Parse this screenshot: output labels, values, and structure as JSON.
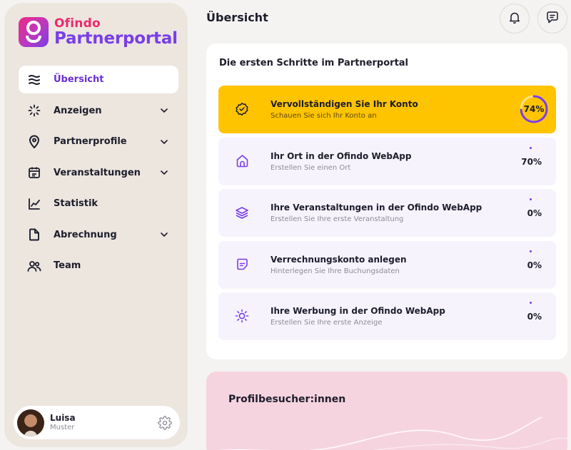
{
  "brand": {
    "line1": "Ofindo",
    "line2": "Partnerportal",
    "accent": "#7a3ee8",
    "pink": "#ec2a6e"
  },
  "sidebar": {
    "items": [
      {
        "label": "Übersicht",
        "icon": "waves-icon",
        "active": true,
        "expandable": false
      },
      {
        "label": "Anzeigen",
        "icon": "sparkle-icon",
        "active": false,
        "expandable": true
      },
      {
        "label": "Partnerprofile",
        "icon": "location-pin-icon",
        "active": false,
        "expandable": true
      },
      {
        "label": "Veranstaltungen",
        "icon": "calendar-icon",
        "active": false,
        "expandable": true
      },
      {
        "label": "Statistik",
        "icon": "line-chart-icon",
        "active": false,
        "expandable": false
      },
      {
        "label": "Abrechnung",
        "icon": "document-icon",
        "active": false,
        "expandable": true
      },
      {
        "label": "Team",
        "icon": "users-icon",
        "active": false,
        "expandable": false
      }
    ]
  },
  "user": {
    "first_name": "Luisa",
    "last_name": "Muster"
  },
  "header": {
    "title": "Übersicht"
  },
  "getting_started": {
    "title": "Die ersten Schritte im Partnerportal",
    "steps": [
      {
        "title": "Vervollständigen Sie Ihr Konto",
        "subtitle": "Schauen Sie sich Ihr Konto an",
        "percent": "74%",
        "progress": 0.74,
        "icon": "badge-check-icon",
        "highlight": true
      },
      {
        "title": "Ihr Ort in der Ofindo WebApp",
        "subtitle": "Erstellen Sie einen Ort",
        "percent": "70%",
        "progress": 0.7,
        "icon": "home-icon",
        "highlight": false
      },
      {
        "title": "Ihre Veranstaltungen in der Ofindo WebApp",
        "subtitle": "Erstellen Sie Ihre erste Veranstaltung",
        "percent": "0%",
        "progress": 0,
        "icon": "layers-icon",
        "highlight": false
      },
      {
        "title": "Verrechnungskonto anlegen",
        "subtitle": "Hinterlegen Sie Ihre Buchungsdaten",
        "percent": "0%",
        "progress": 0,
        "icon": "note-icon",
        "highlight": false
      },
      {
        "title": "Ihre Werbung in der Ofindo WebApp",
        "subtitle": "Erstellen Sie Ihre erste Anzeige",
        "percent": "0%",
        "progress": 0,
        "icon": "sun-icon",
        "highlight": false
      }
    ]
  },
  "visitors": {
    "title": "Profilbesucher:innen"
  }
}
